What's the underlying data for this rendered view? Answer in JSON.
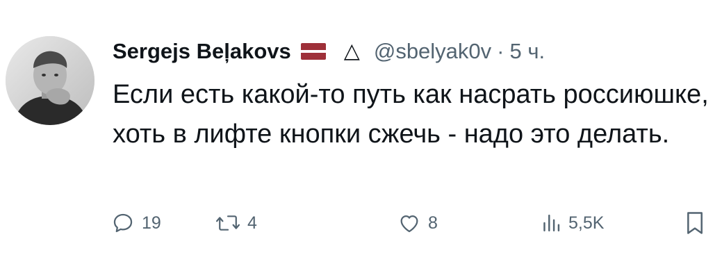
{
  "tweet": {
    "author": {
      "display_name": "Sergejs Beļakovs",
      "handle": "@sbelyak0v",
      "flag": "latvia-flag",
      "badge": "triangle-icon"
    },
    "separator": "·",
    "time": "5 ч.",
    "text": "Если есть какой-то путь как насрать россиюшке, хоть в лифте кнопки сжечь - надо это делать.",
    "actions": {
      "replies": "19",
      "reposts": "4",
      "likes": "8",
      "views": "5,5K"
    }
  },
  "colors": {
    "text": "#0f1419",
    "secondary": "#536471",
    "flag_red": "#9e3039",
    "flag_white": "#ffffff"
  },
  "icons": [
    "reply-icon",
    "repost-icon",
    "like-icon",
    "views-icon",
    "bookmark-icon"
  ]
}
